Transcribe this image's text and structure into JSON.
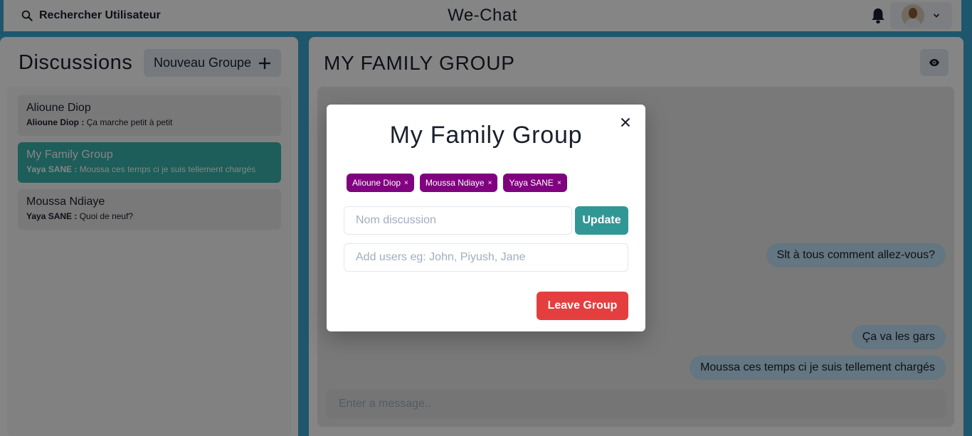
{
  "header": {
    "search_label": "Rechercher Utilisateur",
    "app_title": "We-Chat",
    "icons": {
      "search": "search-icon",
      "bell": "bell-icon",
      "avatar": "avatar",
      "chevron": "chevron-down-icon"
    }
  },
  "sidebar": {
    "title": "Discussions",
    "new_group_label": "Nouveau Groupe",
    "chats": [
      {
        "name": "Alioune Diop",
        "sender": "Alioune Diop :",
        "message": " Ça marche petit à petit",
        "active": false
      },
      {
        "name": "My Family Group",
        "sender": "Yaya SANE :",
        "message": " Moussa ces temps ci je suis tellement chargés",
        "active": true
      },
      {
        "name": "Moussa Ndiaye",
        "sender": "Yaya SANE :",
        "message": " Quoi de neuf?",
        "active": false
      }
    ]
  },
  "conversation": {
    "title": "MY FAMILY GROUP",
    "messages": [
      "Slt à tous comment allez-vous?",
      "Ça va les gars",
      "Moussa ces temps ci je suis tellement chargés"
    ],
    "input_placeholder": "Enter a message.."
  },
  "modal": {
    "title": "My Family Group",
    "members": [
      "Alioune Diop",
      "Moussa Ndiaye",
      "Yaya SANE"
    ],
    "remove_symbol": "×",
    "name_placeholder": "Nom discussion",
    "name_value": "",
    "update_label": "Update",
    "users_placeholder": "Add users eg: John, Piyush, Jane",
    "users_value": "",
    "leave_label": "Leave Group"
  },
  "colors": {
    "active_chat": "#38b2ac",
    "member_badge": "#800080",
    "update_button": "#319795",
    "leave_button": "#e53e3e",
    "message_bubble": "#bee3f8",
    "background": "#3aa8d2"
  }
}
